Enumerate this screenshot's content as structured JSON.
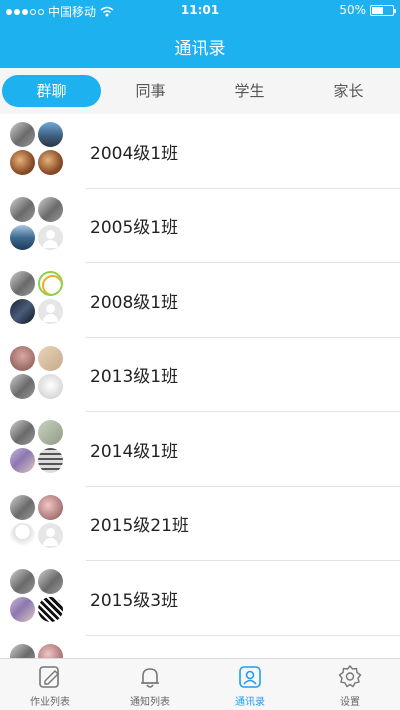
{
  "status_bar": {
    "carrier": "中国移动",
    "time": "11:01",
    "battery_text": "50%",
    "battery_level_percent": 50
  },
  "header": {
    "title": "通讯录"
  },
  "tabs": [
    {
      "label": "群聊",
      "active": true
    },
    {
      "label": "同事",
      "active": false
    },
    {
      "label": "学生",
      "active": false
    },
    {
      "label": "家长",
      "active": false
    }
  ],
  "groups": [
    {
      "name": "2004级1班"
    },
    {
      "name": "2005级1班"
    },
    {
      "name": "2008级1班"
    },
    {
      "name": "2013级1班"
    },
    {
      "name": "2014级1班"
    },
    {
      "name": "2015级21班"
    },
    {
      "name": "2015级3班"
    },
    {
      "name": ""
    }
  ],
  "bottom_nav": [
    {
      "label": "作业列表",
      "icon": "edit-icon",
      "active": false
    },
    {
      "label": "通知列表",
      "icon": "bell-icon",
      "active": false
    },
    {
      "label": "通讯录",
      "icon": "contacts-icon",
      "active": true
    },
    {
      "label": "设置",
      "icon": "gear-icon",
      "active": false
    }
  ],
  "colors": {
    "primary": "#1eb1f0",
    "active_nav": "#1e9ef0",
    "tab_bar_bg": "#f5f5f5",
    "text": "#222222"
  }
}
